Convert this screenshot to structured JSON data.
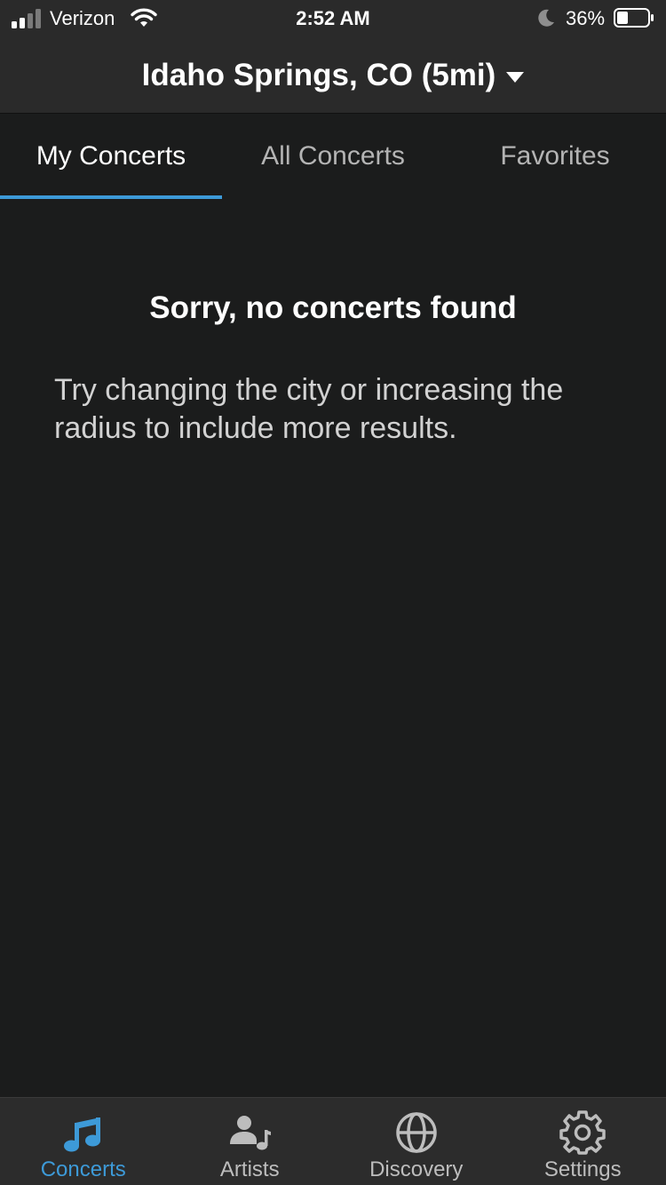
{
  "status_bar": {
    "carrier": "Verizon",
    "time": "2:52 AM",
    "battery_percent": "36%",
    "icons": [
      "signal-icon",
      "wifi-icon",
      "moon-icon",
      "battery-icon"
    ]
  },
  "header": {
    "location": "Idaho Springs, CO (5mi)"
  },
  "tabs": [
    {
      "label": "My Concerts",
      "active": true
    },
    {
      "label": "All Concerts",
      "active": false
    },
    {
      "label": "Favorites",
      "active": false
    }
  ],
  "empty_state": {
    "title": "Sorry, no concerts found",
    "message": "Try changing the city or increasing the radius to include more results."
  },
  "tab_bar": {
    "items": [
      {
        "label": "Concerts",
        "icon": "music-note-icon",
        "active": true
      },
      {
        "label": "Artists",
        "icon": "artist-icon",
        "active": false
      },
      {
        "label": "Discovery",
        "icon": "globe-icon",
        "active": false
      },
      {
        "label": "Settings",
        "icon": "gear-icon",
        "active": false
      }
    ]
  },
  "colors": {
    "accent": "#3d9ad8",
    "background": "#1b1c1c",
    "bar": "#2a2a2a"
  }
}
